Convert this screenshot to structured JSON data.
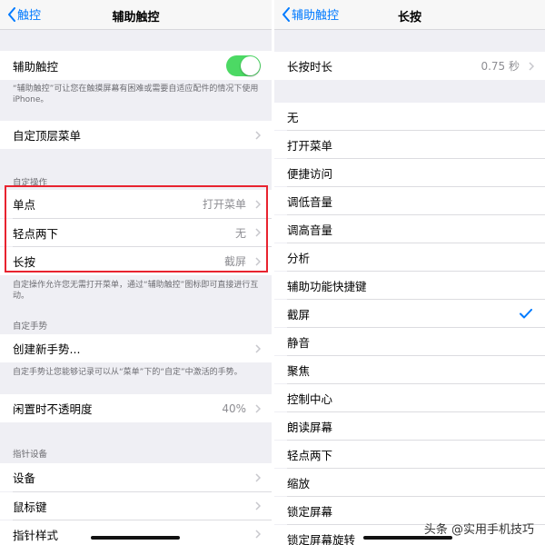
{
  "left": {
    "back_label": "触控",
    "title": "辅助触控",
    "assistive_touch": {
      "label": "辅助触控",
      "enabled": true
    },
    "assistive_note": "“辅助触控”可让您在触摸屏幕有困难或需要自适应配件的情况下使用iPhone。",
    "custom_top_menu": "自定顶层菜单",
    "custom_actions_header": "自定操作",
    "actions": [
      {
        "label": "单点",
        "value": "打开菜单"
      },
      {
        "label": "轻点两下",
        "value": "无"
      },
      {
        "label": "长按",
        "value": "截屏"
      }
    ],
    "actions_note": "自定操作允许您无需打开菜单，通过“辅助触控”图标即可直接进行互动。",
    "custom_gestures_header": "自定手势",
    "create_gesture": "创建新手势...",
    "gestures_note": "自定手势让您能够记录可以从“菜单”下的“自定”中激活的手势。",
    "idle_opacity": {
      "label": "闲置时不透明度",
      "value": "40%"
    },
    "pointer_header": "指针设备",
    "pointer_items": [
      "设备",
      "鼠标键",
      "指针样式"
    ]
  },
  "right": {
    "back_label": "辅助触控",
    "title": "长按",
    "duration": {
      "label": "长按时长",
      "value": "0.75 秒"
    },
    "options": [
      "无",
      "打开菜单",
      "便捷访问",
      "调低音量",
      "调高音量",
      "分析",
      "辅助功能快捷键",
      "截屏",
      "静音",
      "聚焦",
      "控制中心",
      "朗读屏幕",
      "轻点两下",
      "缩放",
      "锁定屏幕",
      "锁定屏幕旋转"
    ],
    "selected_option": "截屏"
  },
  "watermark": "头条 @实用手机技巧",
  "colors": {
    "accent": "#007aff",
    "toggle_on": "#4cd964",
    "highlight": "#e8232f"
  }
}
